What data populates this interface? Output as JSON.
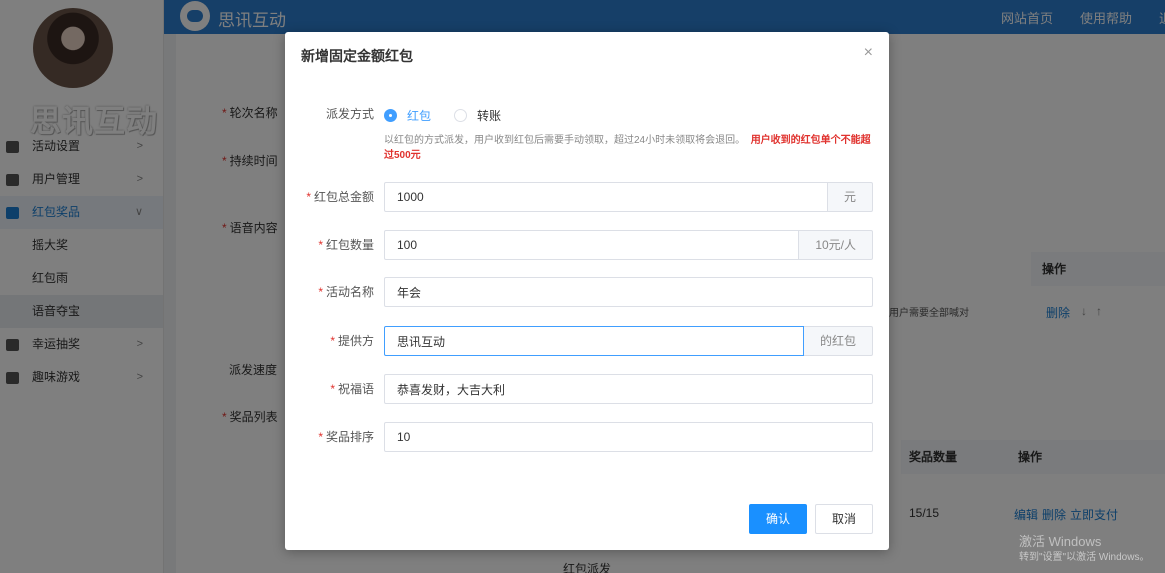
{
  "app": {
    "brand": "思讯互动",
    "logo_text": "思讯互动",
    "top_links": [
      "网站首页",
      "使用帮助",
      "退"
    ]
  },
  "sidebar": {
    "items": [
      {
        "label": "活动设置",
        "icon": "gear-icon"
      },
      {
        "label": "用户管理",
        "icon": "user-icon"
      },
      {
        "label": "红包奖品",
        "icon": "gift-icon"
      },
      {
        "label": "摇大奖",
        "sub": true
      },
      {
        "label": "红包雨",
        "sub": true
      },
      {
        "label": "语音夺宝",
        "sub": true
      },
      {
        "label": "幸运抽奖",
        "icon": "lottery-icon"
      },
      {
        "label": "趣味游戏",
        "icon": "game-icon"
      }
    ]
  },
  "background_form": {
    "labels": [
      "轮次名称",
      "持续时间",
      "语音内容",
      "派发速度",
      "奖品列表"
    ],
    "table1_head": "操作",
    "table1_cell": "用户需要全部喊对",
    "table1_actions": [
      "删除",
      "↓",
      "↑"
    ],
    "table2_heads": [
      "奖品数量",
      "操作"
    ],
    "table2_count": "15/15",
    "table2_actions": [
      "编辑",
      "删除",
      "立即支付"
    ],
    "footer_text": "红包派发"
  },
  "watermark": {
    "line1": "激活 Windows",
    "line2": "转到\"设置\"以激活 Windows。"
  },
  "modal": {
    "title": "新增固定金额红包",
    "close": "×",
    "dispatch": {
      "label": "派发方式",
      "options": [
        "红包",
        "转账"
      ],
      "selected": "红包"
    },
    "hint": "以红包的方式派发，用户收到红包后需要手动领取，超过24小时未领取将会退回。",
    "hint_warn": "用户收到的红包单个不能超过500元",
    "fields": {
      "total": {
        "label": "红包总金额",
        "value": "1000",
        "append": "元"
      },
      "count": {
        "label": "红包数量",
        "value": "100",
        "append": "10元/人"
      },
      "activity": {
        "label": "活动名称",
        "value": "年会"
      },
      "provider": {
        "label": "提供方",
        "value": "思讯互动",
        "append": "的红包"
      },
      "blessing": {
        "label": "祝福语",
        "value": "恭喜发财，大吉大利"
      },
      "order": {
        "label": "奖品排序",
        "value": "10"
      }
    },
    "confirm": "确认",
    "cancel": "取消"
  }
}
